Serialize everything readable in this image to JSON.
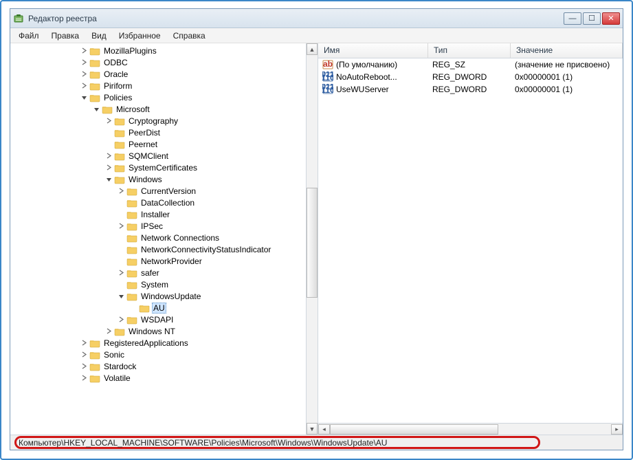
{
  "window": {
    "title": "Редактор реестра"
  },
  "menu": {
    "file": "Файл",
    "edit": "Правка",
    "view": "Вид",
    "favorites": "Избранное",
    "help": "Справка"
  },
  "tree": [
    {
      "depth": 4,
      "exp": "closed",
      "label": "MozillaPlugins"
    },
    {
      "depth": 4,
      "exp": "closed",
      "label": "ODBC"
    },
    {
      "depth": 4,
      "exp": "closed",
      "label": "Oracle"
    },
    {
      "depth": 4,
      "exp": "closed",
      "label": "Piriform"
    },
    {
      "depth": 4,
      "exp": "open",
      "label": "Policies"
    },
    {
      "depth": 5,
      "exp": "open",
      "label": "Microsoft"
    },
    {
      "depth": 6,
      "exp": "closed",
      "label": "Cryptography"
    },
    {
      "depth": 6,
      "exp": "none",
      "label": "PeerDist"
    },
    {
      "depth": 6,
      "exp": "none",
      "label": "Peernet"
    },
    {
      "depth": 6,
      "exp": "closed",
      "label": "SQMClient"
    },
    {
      "depth": 6,
      "exp": "closed",
      "label": "SystemCertificates"
    },
    {
      "depth": 6,
      "exp": "open",
      "label": "Windows"
    },
    {
      "depth": 7,
      "exp": "closed",
      "label": "CurrentVersion"
    },
    {
      "depth": 7,
      "exp": "none",
      "label": "DataCollection"
    },
    {
      "depth": 7,
      "exp": "none",
      "label": "Installer"
    },
    {
      "depth": 7,
      "exp": "closed",
      "label": "IPSec"
    },
    {
      "depth": 7,
      "exp": "none",
      "label": "Network Connections"
    },
    {
      "depth": 7,
      "exp": "none",
      "label": "NetworkConnectivityStatusIndicator"
    },
    {
      "depth": 7,
      "exp": "none",
      "label": "NetworkProvider"
    },
    {
      "depth": 7,
      "exp": "closed",
      "label": "safer"
    },
    {
      "depth": 7,
      "exp": "none",
      "label": "System"
    },
    {
      "depth": 7,
      "exp": "open",
      "label": "WindowsUpdate"
    },
    {
      "depth": 8,
      "exp": "none",
      "label": "AU",
      "selected": true
    },
    {
      "depth": 7,
      "exp": "closed",
      "label": "WSDAPI"
    },
    {
      "depth": 6,
      "exp": "closed",
      "label": "Windows NT"
    },
    {
      "depth": 4,
      "exp": "closed",
      "label": "RegisteredApplications"
    },
    {
      "depth": 4,
      "exp": "closed",
      "label": "Sonic"
    },
    {
      "depth": 4,
      "exp": "closed",
      "label": "Stardock"
    },
    {
      "depth": 4,
      "exp": "closed",
      "label": "Volatile"
    }
  ],
  "list": {
    "columns": {
      "name": "Имя",
      "type": "Тип",
      "data": "Значение"
    },
    "rows": [
      {
        "icon": "sz",
        "name": "(По умолчанию)",
        "type": "REG_SZ",
        "data": "(значение не присвоено)"
      },
      {
        "icon": "dword",
        "name": "NoAutoReboot...",
        "type": "REG_DWORD",
        "data": "0x00000001 (1)"
      },
      {
        "icon": "dword",
        "name": "UseWUServer",
        "type": "REG_DWORD",
        "data": "0x00000001 (1)"
      }
    ]
  },
  "status": {
    "path": "Компьютер\\HKEY_LOCAL_MACHINE\\SOFTWARE\\Policies\\Microsoft\\Windows\\WindowsUpdate\\AU"
  }
}
